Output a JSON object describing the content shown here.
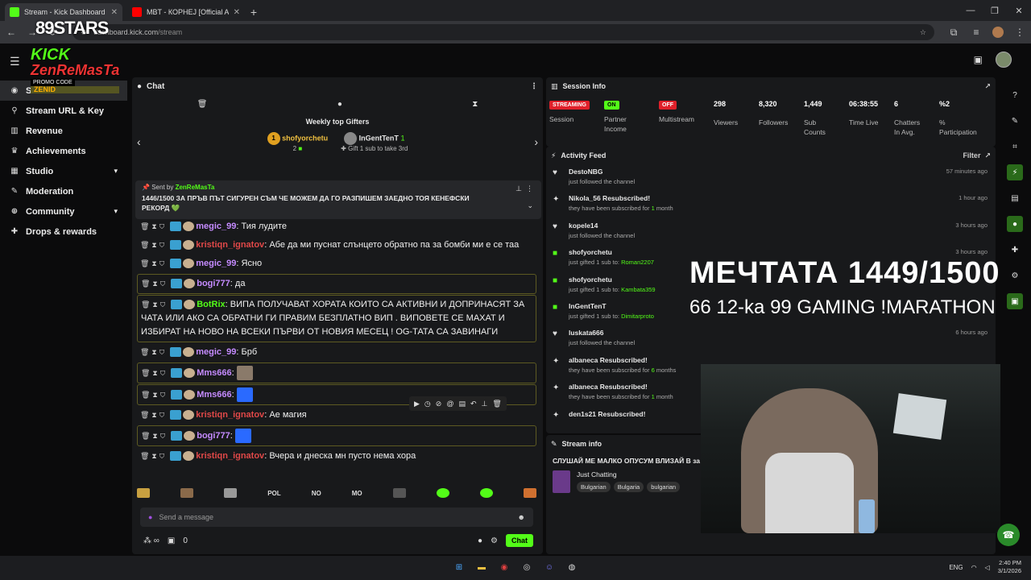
{
  "browser": {
    "tabs": [
      {
        "title": "Stream - Kick Dashboard",
        "active": true,
        "favicon_color": "#53fc18"
      },
      {
        "title": "MBT - КОРНЕЈ [Official Au",
        "active": false,
        "favicon_color": "#ff0000"
      }
    ],
    "url_host": "dashboard.kick.com",
    "url_path": "/stream"
  },
  "overlay": {
    "logo_top": "89STARS",
    "kick": "KICK",
    "zenremasta": "ZenReMasTa",
    "promo": "PROMO CODE",
    "zenid": "ZENID",
    "title": "МЕЧТАТА 1449/1500",
    "subtitle": "66 12-ka 99 GAMING !MARATHON"
  },
  "sidebar": {
    "items": [
      {
        "label": "Stream",
        "icon": "broadcast-icon",
        "active": true
      },
      {
        "label": "Stream URL & Key",
        "icon": "link-icon"
      },
      {
        "label": "Revenue",
        "icon": "chart-icon"
      },
      {
        "label": "Achievements",
        "icon": "trophy-icon"
      },
      {
        "label": "Studio",
        "icon": "grid-icon",
        "chevron": true
      },
      {
        "label": "Moderation",
        "icon": "wrench-icon"
      },
      {
        "label": "Community",
        "icon": "globe-icon",
        "chevron": true
      },
      {
        "label": "Drops & rewards",
        "icon": "gift-icon"
      }
    ]
  },
  "chat": {
    "title": "Chat",
    "gifters": {
      "title": "Weekly top Gifters",
      "first": {
        "rank": "1",
        "name": "shofyorchetu",
        "count": "2"
      },
      "second": {
        "name": "InGentTenT",
        "count": "1",
        "hint": "Gift 1 sub to take 3rd"
      }
    },
    "pinned": {
      "sent_by": "Sent by",
      "user": "ZenReMasTa",
      "message": "1446/1500 ЗА ПРЪВ ПЪТ СИГУРЕН СЪМ ЧЕ МОЖЕМ ДА ГО РАЗПИШЕМ ЗАЕДНО ТОЯ КЕНЕФСКИ РЕКОРД 💚"
    },
    "messages": [
      {
        "user": "megic_99",
        "color": "#c58bff",
        "text": "Тия лудите",
        "hl": false
      },
      {
        "user": "kristiqn_ignatov",
        "color": "#e04848",
        "text": "Абе да ми пуснат слънцето обратно па за бомби ми е се таа",
        "hl": false
      },
      {
        "user": "megic_99",
        "color": "#c58bff",
        "text": "Ясно",
        "hl": false
      },
      {
        "user": "bogi777",
        "color": "#c58bff",
        "text": "да",
        "hl": true
      },
      {
        "user": "BotRix",
        "color": "#53fc18",
        "text": "ВИПА ПОЛУЧАВАТ ХОРАТА КОИТО СА АКТИВНИ И ДОПРИНАСЯТ ЗА ЧАТА ИЛИ АКО СА ОБРАТНИ ГИ ПРАВИМ БЕЗПЛАТНО ВИП . ВИПОВЕТЕ СЕ МАХАТ И ИЗБИРАТ НА НОВО НА ВСЕКИ ПЪРВИ ОТ НОВИЯ МЕСЕЦ ! OG-ТАТА СА ЗАВИНАГИ",
        "hl": true
      },
      {
        "user": "megic_99",
        "color": "#c58bff",
        "text": "Брб",
        "hl": false
      },
      {
        "user": "Mms666",
        "color": "#c58bff",
        "text": "",
        "hl": true,
        "emote": "#8a7a6a"
      },
      {
        "user": "Mms666",
        "color": "#c58bff",
        "text": "",
        "hl": true,
        "emote": "#2a6aff"
      },
      {
        "user": "kristiqn_ignatov",
        "color": "#e04848",
        "text": "Ае магия",
        "hl": false
      },
      {
        "user": "bogi777",
        "color": "#c58bff",
        "text": "",
        "hl": true,
        "emote": "#2a6aff"
      },
      {
        "user": "kristiqn_ignatov",
        "color": "#e04848",
        "text": "Вчера и днеска мн пусто нема хора",
        "hl": false
      }
    ],
    "emote_labels": [
      "POL",
      "NO",
      "MO"
    ],
    "input_placeholder": "Send a message",
    "footer": {
      "count": "0",
      "chat_button": "Chat"
    }
  },
  "session": {
    "title": "Session Info",
    "items": [
      {
        "pill": "STREAMING",
        "pill_color": "#e0202a",
        "label": "Session"
      },
      {
        "pill": "ON",
        "pill_color": "#53fc18",
        "label": "Partner Income"
      },
      {
        "pill": "OFF",
        "pill_color": "#e0202a",
        "label": "Multistream"
      },
      {
        "value": "298",
        "label": "Viewers"
      },
      {
        "value": "8,320",
        "label": "Followers"
      },
      {
        "value": "1,449",
        "label": "Sub Counts"
      },
      {
        "value": "06:38:55",
        "label": "Time Live"
      },
      {
        "value": "6",
        "label": "Chatters In Avg."
      },
      {
        "value": "%2",
        "label": "% Participation"
      }
    ]
  },
  "activity": {
    "title": "Activity Feed",
    "filter": "Filter",
    "items": [
      {
        "name": "DestoNBG",
        "desc": "just followed the channel",
        "time": "57 minutes ago",
        "icon": "heart-icon"
      },
      {
        "name": "Nikola_56 Resubscribed!",
        "desc": "they have been subscribed for",
        "hl": "1",
        "tail": " month",
        "time": "1 hour ago",
        "icon": "star-icon"
      },
      {
        "name": "kopele14",
        "desc": "just followed the channel",
        "time": "3 hours ago",
        "icon": "heart-icon"
      },
      {
        "name": "shofyorchetu",
        "desc": "just gifted 1 sub to:",
        "hl": "Roman2207",
        "time": "3 hours ago",
        "icon": "gift-icon"
      },
      {
        "name": "shofyorchetu",
        "desc": "just gifted 1 sub to:",
        "hl": "Kambata359",
        "time": "",
        "icon": "gift-icon"
      },
      {
        "name": "InGentTenT",
        "desc": "just gifted 1 sub to:",
        "hl": "Dimitarproto",
        "time": "",
        "icon": "gift-icon"
      },
      {
        "name": "luskata666",
        "desc": "just followed the channel",
        "time": "6 hours ago",
        "icon": "heart-icon"
      },
      {
        "name": "albaneca Resubscribed!",
        "desc": "they have been subscribed for",
        "hl": "6",
        "tail": " months",
        "time": "",
        "icon": "star-icon"
      },
      {
        "name": "albaneca Resubscribed!",
        "desc": "they have been subscribed for",
        "hl": "1",
        "tail": " month",
        "time": "",
        "icon": "star-icon"
      },
      {
        "name": "den1s21 Resubscribed!",
        "desc": "",
        "time": "",
        "icon": "star-icon"
      }
    ]
  },
  "stream_info": {
    "title": "Stream info",
    "stream_title": "СЛУШАЙ МЕ МАЛКО ОПУСУМ ВЛИЗАЙ В за всекидневни стриймове <3 🟢",
    "category": "Just Chatting",
    "tags": [
      "Bulgarian",
      "Bulgaria",
      "bulgarian"
    ]
  },
  "taskbar": {
    "lang": "ENG",
    "time": "2:40 PM",
    "date": "3/1/2026"
  }
}
